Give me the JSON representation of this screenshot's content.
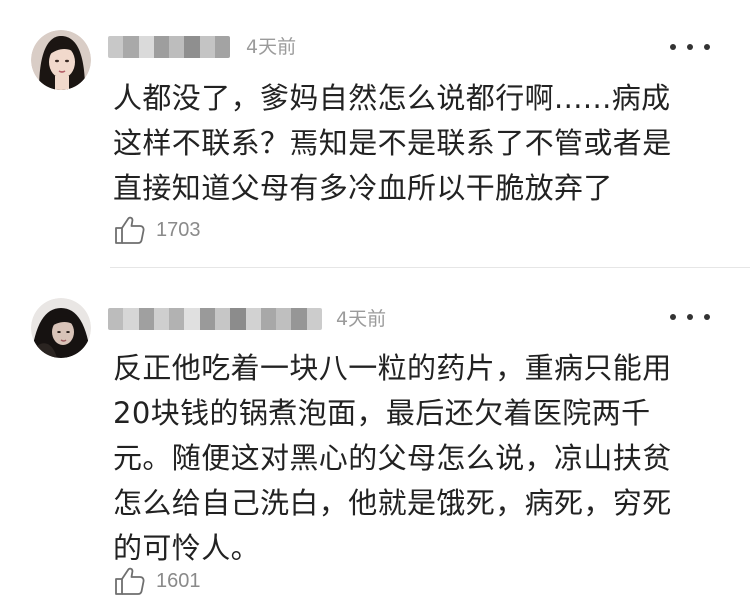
{
  "comments": [
    {
      "time": "4天前",
      "lines": [
        "人都没了，爹妈自然怎么说都行啊......病成",
        "这样不联系？焉知是不是联系了不管或者是",
        "直接知道父母有多冷血所以干脆放弃了"
      ],
      "likes": "1703",
      "avatar_icon": "user-avatar-photo",
      "more_icon": "more-dots-icon",
      "like_icon": "thumbs-up-icon"
    },
    {
      "time": "4天前",
      "lines": [
        "反正他吃着一块八一粒的药片，重病只能用",
        "20块钱的锅煮泡面，最后还欠着医院两千",
        "元。随便这对黑心的父母怎么说，凉山扶贫",
        "怎么给自己洗白，他就是饿死，病死，穷死",
        "的可怜人。"
      ],
      "likes": "1601",
      "avatar_icon": "user-avatar-photo",
      "more_icon": "more-dots-icon",
      "like_icon": "thumbs-up-icon"
    }
  ],
  "colors": {
    "text": "#222222",
    "meta": "#9b9b9b",
    "like_count": "#8a8a8a",
    "divider": "#e6e6e6"
  }
}
